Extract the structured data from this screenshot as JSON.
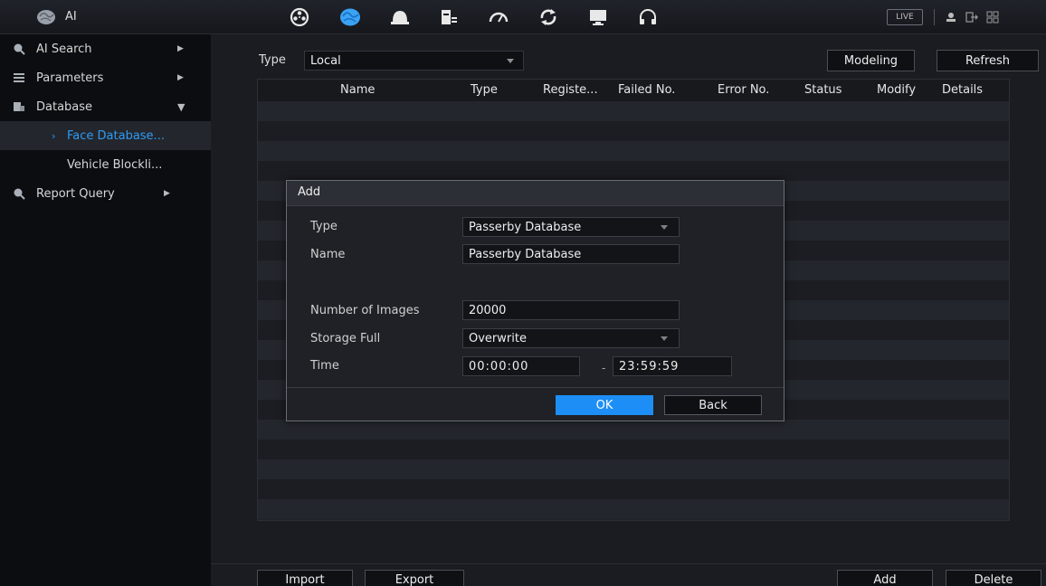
{
  "header": {
    "title": "AI",
    "nav_icons": [
      "film-reel-icon",
      "ai-brain-icon",
      "camera-dome-icon",
      "storage-icon",
      "speedometer-icon",
      "refresh-sync-icon",
      "monitor-icon",
      "headset-icon"
    ],
    "live_label": "LIVE",
    "right_icons": [
      "user-icon",
      "logout-icon",
      "grid-menu-icon"
    ]
  },
  "sidebar": {
    "items": [
      {
        "label": "AI Search",
        "icon": "ai-search-icon"
      },
      {
        "label": "Parameters",
        "icon": "list-icon"
      },
      {
        "label": "Database",
        "icon": "database-icon"
      },
      {
        "label": "Report Query",
        "icon": "report-query-icon"
      }
    ],
    "sub_items": [
      {
        "label": "Face Database...",
        "active": true
      },
      {
        "label": "Vehicle Blockli...",
        "active": false
      }
    ]
  },
  "main": {
    "type_label": "Type",
    "type_value": "Local",
    "modeling_label": "Modeling",
    "refresh_label": "Refresh",
    "table": {
      "columns": [
        "Name",
        "Type",
        "Registe...",
        "Failed No.",
        "Error No.",
        "Status",
        "Modify",
        "Details"
      ]
    },
    "import_label": "Import",
    "export_label": "Export",
    "add_label": "Add",
    "delete_label": "Delete"
  },
  "modal": {
    "title": "Add",
    "type_label": "Type",
    "type_value": "Passerby Database",
    "name_label": "Name",
    "name_value": "Passerby Database",
    "images_label": "Number of Images",
    "images_value": "20000",
    "storage_label": "Storage Full",
    "storage_value": "Overwrite",
    "time_label": "Time",
    "time_start": "00:00:00",
    "time_separator": "-",
    "time_end": "23:59:59",
    "ok_label": "OK",
    "back_label": "Back"
  },
  "colors": {
    "accent": "#1d8ef5",
    "active_text": "#2f9bf2",
    "background": "#1a1c21"
  }
}
